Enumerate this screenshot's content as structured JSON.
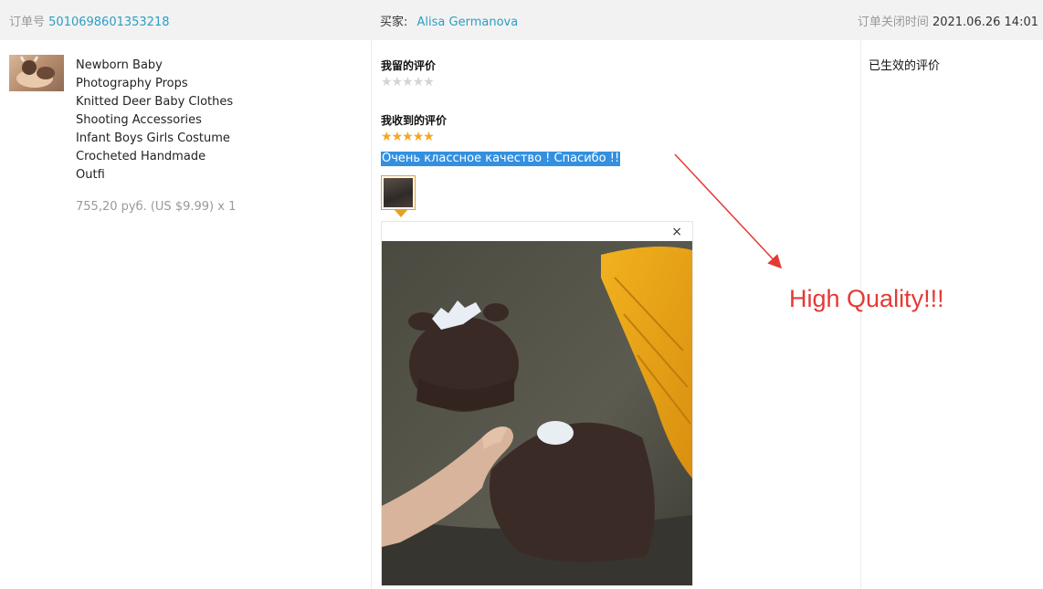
{
  "header": {
    "order_label": "订单号",
    "order_number": "5010698601353218",
    "buyer_label": "买家:",
    "buyer_name": "Alisa Germanova",
    "close_time_label": "订单关闭时间",
    "close_time_value": "2021.06.26 14:01"
  },
  "product": {
    "title_lines": [
      "Newborn Baby",
      "Photography Props",
      "Knitted Deer Baby Clothes",
      "Shooting Accessories",
      "Infant Boys Girls Costume",
      "Crocheted Handmade",
      "Outfi"
    ],
    "price": "755,20 руб. (US $9.99) x 1"
  },
  "reviews": {
    "my_review_title": "我留的评价",
    "my_review_stars": 0,
    "received_review_title": "我收到的评价",
    "received_review_stars": 5,
    "received_review_text": "Очень классное качество ! Спасибо !!",
    "close_glyph": "×"
  },
  "status": {
    "effective_label": "已生效的评价"
  },
  "annotation": {
    "text": "High Quality!!!",
    "color": "#e53935"
  },
  "colors": {
    "link": "#2a9fc4",
    "star_active": "#f5a623",
    "star_inactive": "#d4d4d4",
    "selection": "#3390e0"
  }
}
